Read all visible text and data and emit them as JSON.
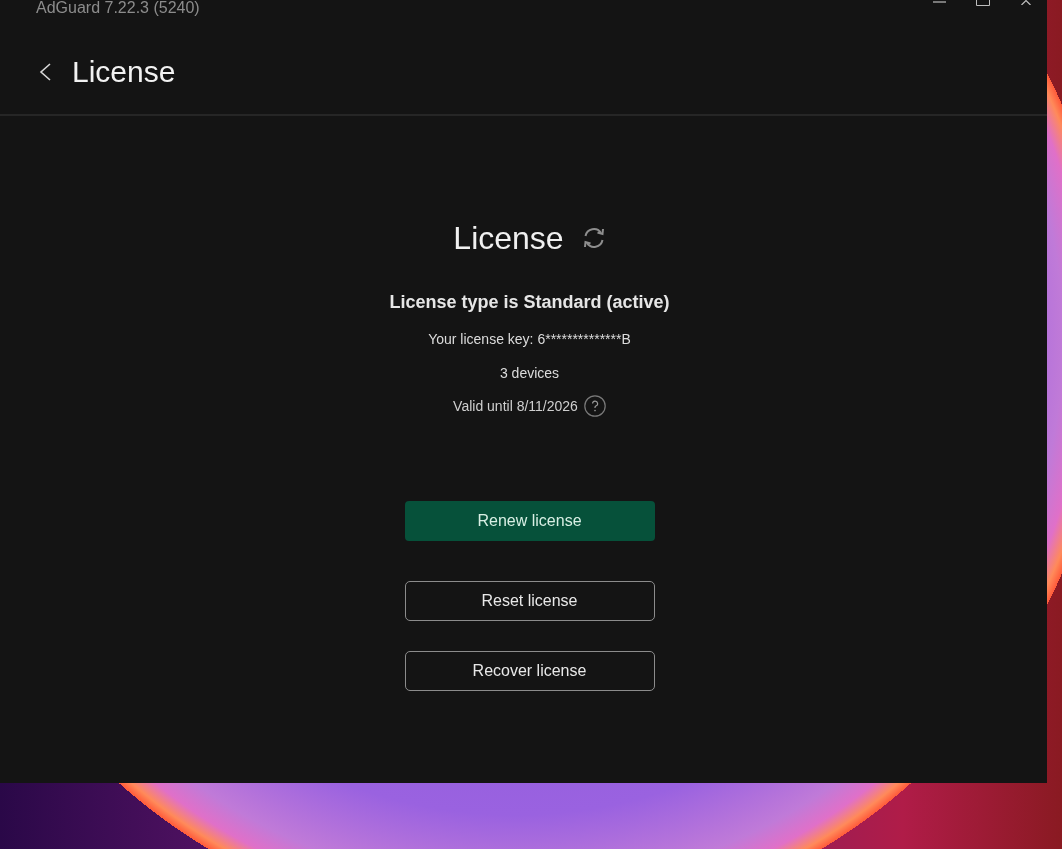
{
  "window": {
    "title": "AdGuard 7.22.3 (5240)"
  },
  "header": {
    "title": "License"
  },
  "license": {
    "title": "License",
    "type": "License type is Standard (active)",
    "key": "Your license key: 6**************B",
    "devices": "3 devices",
    "valid_until": "Valid until 8/11/2026"
  },
  "buttons": [
    {
      "label": "Renew license",
      "kind": "primary"
    },
    {
      "label": "Reset license",
      "kind": "outline"
    },
    {
      "label": "Recover license",
      "kind": "outline"
    }
  ]
}
